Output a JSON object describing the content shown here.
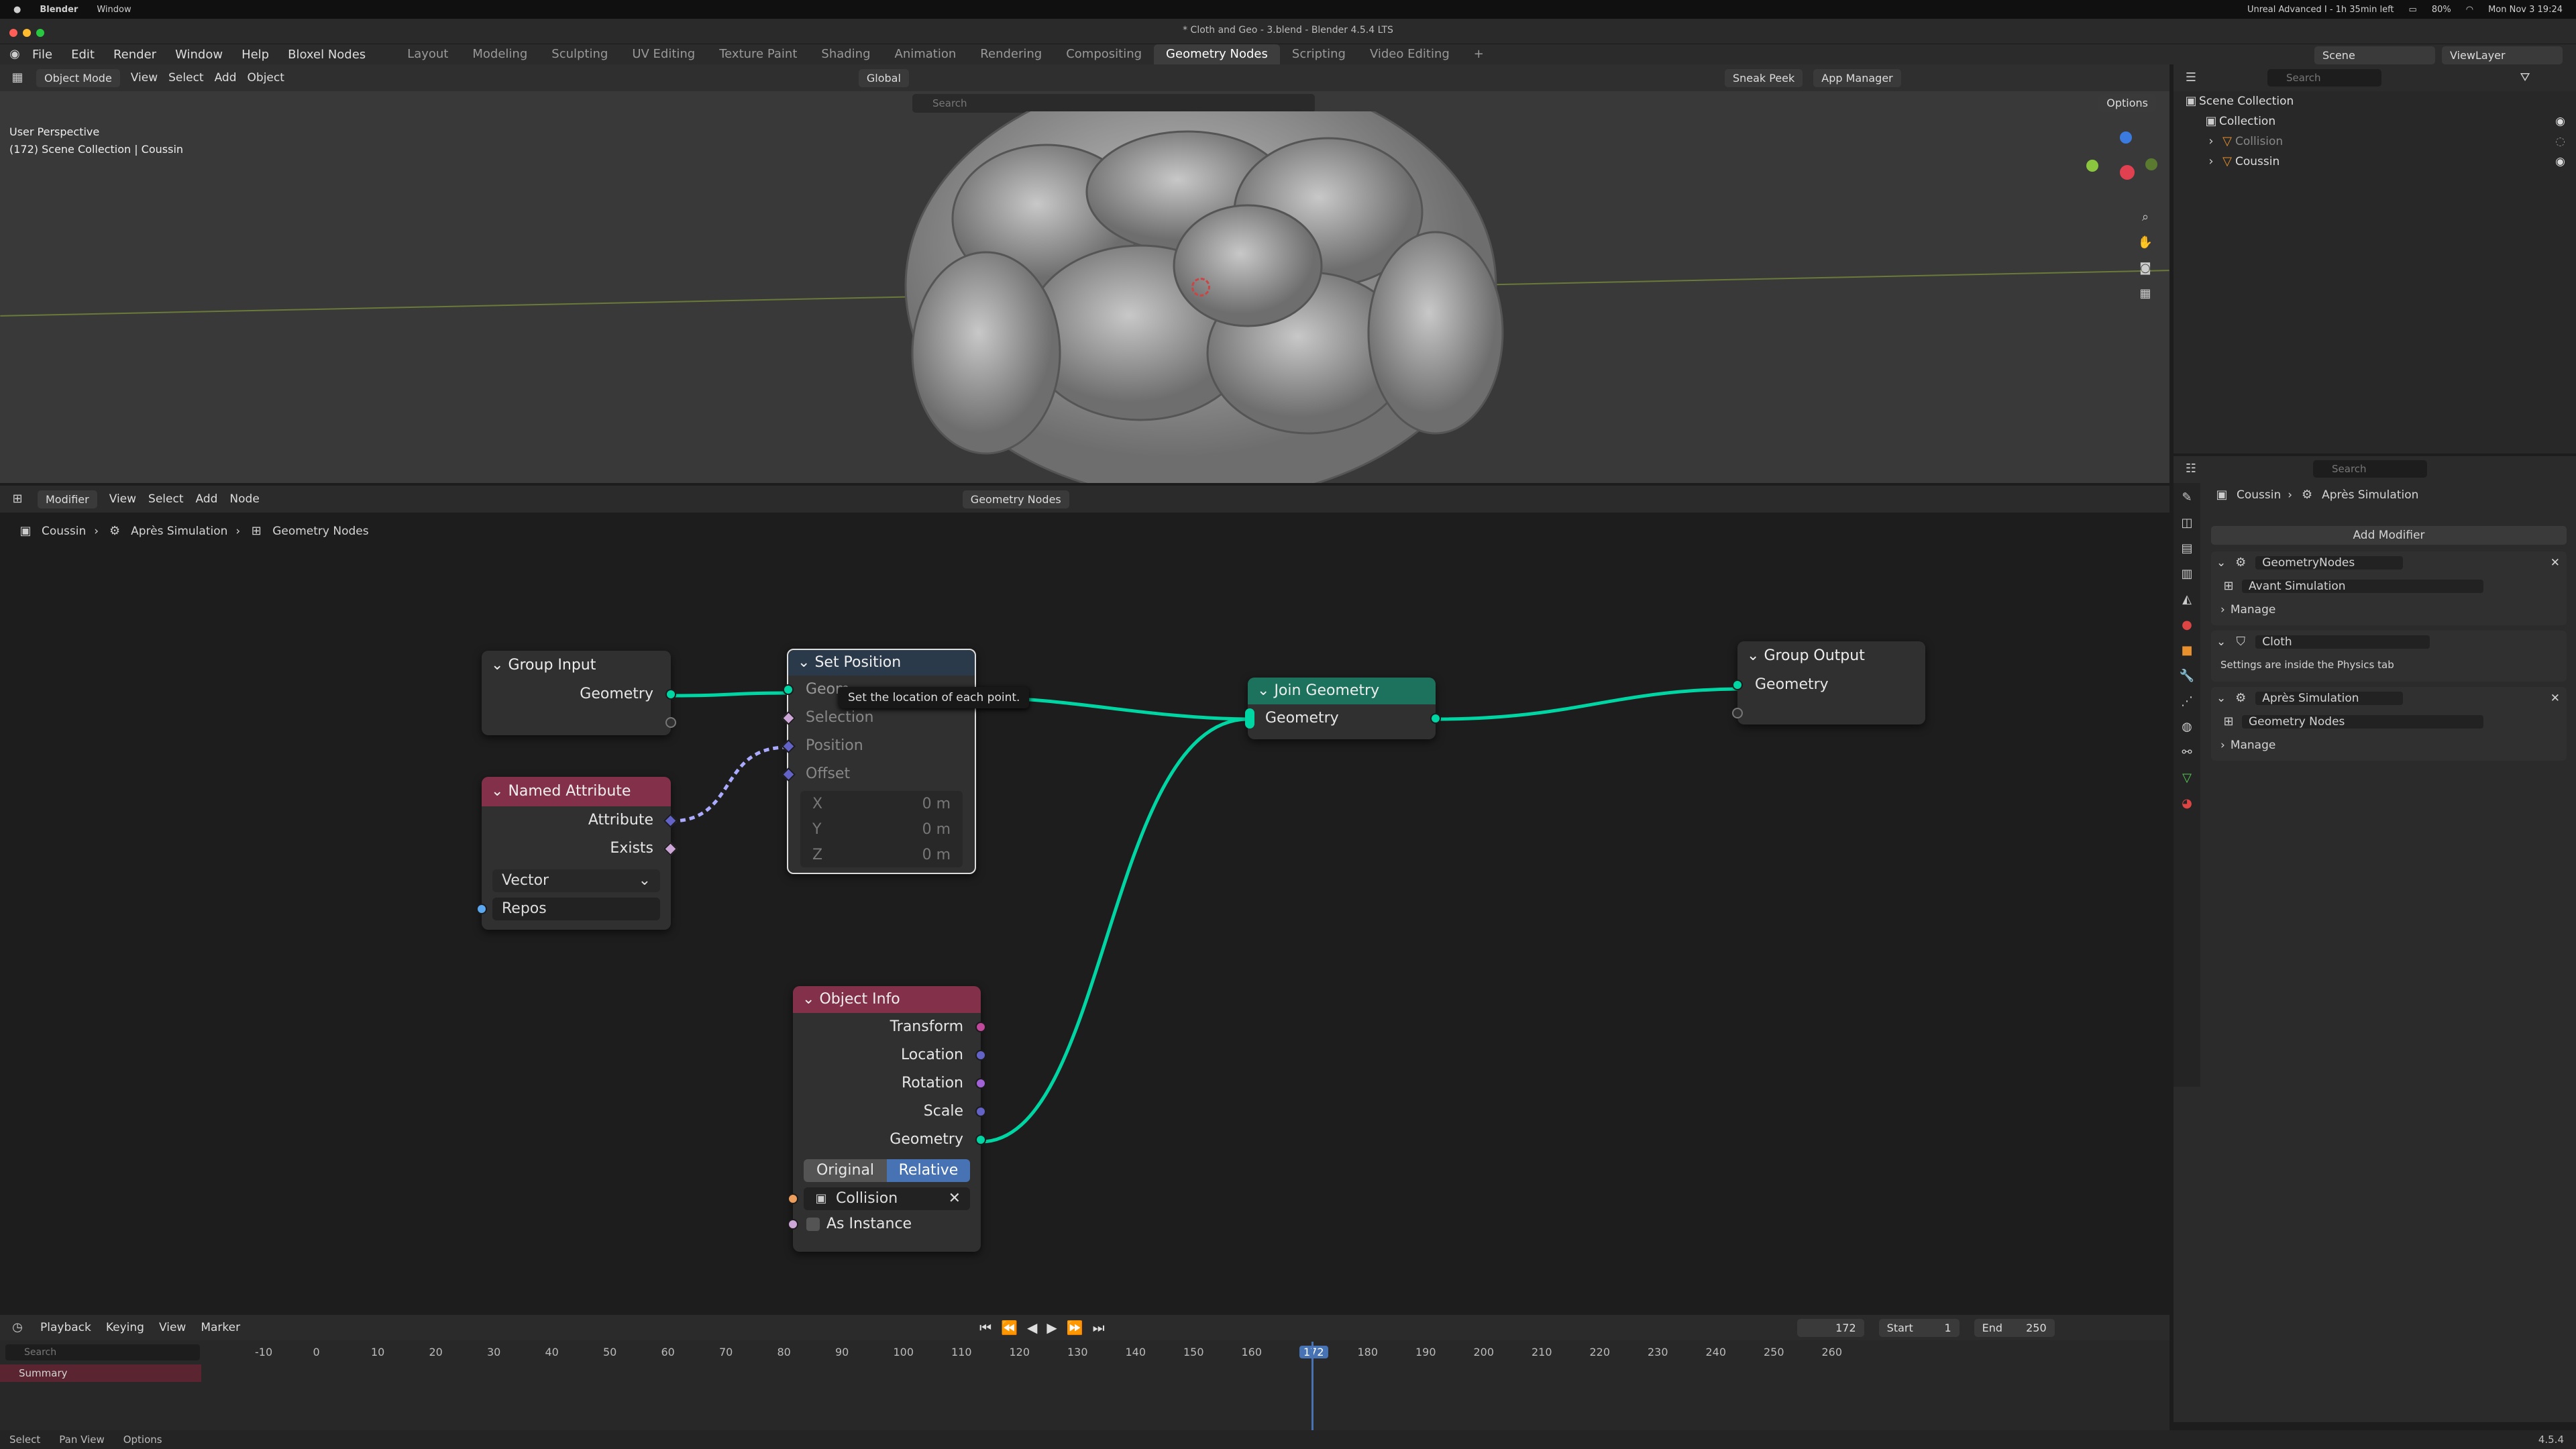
{
  "macbar": {
    "apple": "",
    "app": "Blender",
    "menu": "Window",
    "status": "Unreal Advanced I - 1h 35min left",
    "battery": "80%",
    "clock": "Mon Nov 3 19:24"
  },
  "window": {
    "title": "* Cloth and Geo - 3.blend - Blender 4.5.4 LTS"
  },
  "menus": [
    "File",
    "Edit",
    "Render",
    "Window",
    "Help",
    "Bloxel Nodes"
  ],
  "workspaces": [
    "Layout",
    "Modeling",
    "Sculpting",
    "UV Editing",
    "Texture Paint",
    "Shading",
    "Animation",
    "Rendering",
    "Compositing",
    "Geometry Nodes",
    "Scripting",
    "Video Editing"
  ],
  "active_workspace": "Geometry Nodes",
  "scene": {
    "label": "Scene",
    "viewlayer": "ViewLayer"
  },
  "viewport": {
    "mode": "Object Mode",
    "menus": [
      "View",
      "Select",
      "Add",
      "Object"
    ],
    "transform": "Global",
    "search_placeholder": "Search",
    "sneak_peek": "Sneak Peek",
    "app_manager": "App Manager",
    "options": "Options",
    "overlay_line1": "User Perspective",
    "overlay_line2": "(172) Scene Collection | Coussin"
  },
  "outliner": {
    "search_placeholder": "Search",
    "items": [
      {
        "label": "Scene Collection",
        "level": 0
      },
      {
        "label": "Collection",
        "level": 1
      },
      {
        "label": "Collision",
        "level": 2
      },
      {
        "label": "Coussin",
        "level": 2
      }
    ]
  },
  "node_editor": {
    "type": "Modifier",
    "menus": [
      "View",
      "Select",
      "Add",
      "Node"
    ],
    "tree_name": "Geometry Nodes",
    "breadcrumb": [
      "Coussin",
      "Après Simulation",
      "Geometry Nodes"
    ],
    "tooltip": "Set the location of each point."
  },
  "nodes": {
    "group_input": {
      "title": "Group Input",
      "out": "Geometry"
    },
    "named_attribute": {
      "title": "Named Attribute",
      "outs": [
        "Attribute",
        "Exists"
      ],
      "type": "Vector",
      "name": "Repos"
    },
    "set_position": {
      "title": "Set Position",
      "inputs": [
        "Geom",
        "Selection",
        "Position",
        "Offset"
      ],
      "x": "X",
      "y": "Y",
      "z": "Z",
      "xv": "0 m",
      "yv": "0 m",
      "zv": "0 m"
    },
    "join_geometry": {
      "title": "Join Geometry",
      "socket": "Geometry"
    },
    "group_output": {
      "title": "Group Output",
      "socket": "Geometry"
    },
    "object_info": {
      "title": "Object Info",
      "outs": [
        "Transform",
        "Location",
        "Rotation",
        "Scale",
        "Geometry"
      ],
      "opt1": "Original",
      "opt2": "Relative",
      "object": "Collision",
      "as_instance": "As Instance"
    }
  },
  "properties": {
    "search_placeholder": "Search",
    "breadcrumb": [
      "Coussin",
      "Après Simulation"
    ],
    "add_modifier": "Add Modifier",
    "modifiers": [
      {
        "name": "GeometryNodes",
        "group": "Avant Simulation",
        "manage": "Manage"
      },
      {
        "name": "Cloth",
        "note": "Settings are inside the Physics tab"
      },
      {
        "name": "Après Simulation",
        "group": "Geometry Nodes",
        "manage": "Manage"
      }
    ]
  },
  "timeline": {
    "menus": [
      "Playback",
      "Keying",
      "View",
      "Marker"
    ],
    "current": "172",
    "start_label": "Start",
    "start": "1",
    "end_label": "End",
    "end": "250",
    "search_placeholder": "Search",
    "summary": "Summary",
    "ticks": [
      "-10",
      "0",
      "10",
      "20",
      "30",
      "40",
      "50",
      "60",
      "70",
      "80",
      "90",
      "100",
      "110",
      "120",
      "130",
      "140",
      "150",
      "160",
      "172",
      "180",
      "190",
      "200",
      "210",
      "220",
      "230",
      "240",
      "250",
      "260"
    ]
  },
  "statusbar": {
    "select": "Select",
    "pan": "Pan View",
    "options": "Options",
    "version": "4.5.4"
  },
  "colors": {
    "accent": "#4772b3",
    "geometry_socket": "#00d6a3",
    "named_attr_header": "#83314a",
    "join_header": "#1d725e",
    "object_info_header": "#83314a",
    "vector_socket": "#6363c7",
    "bool_socket": "#cca6d6"
  }
}
